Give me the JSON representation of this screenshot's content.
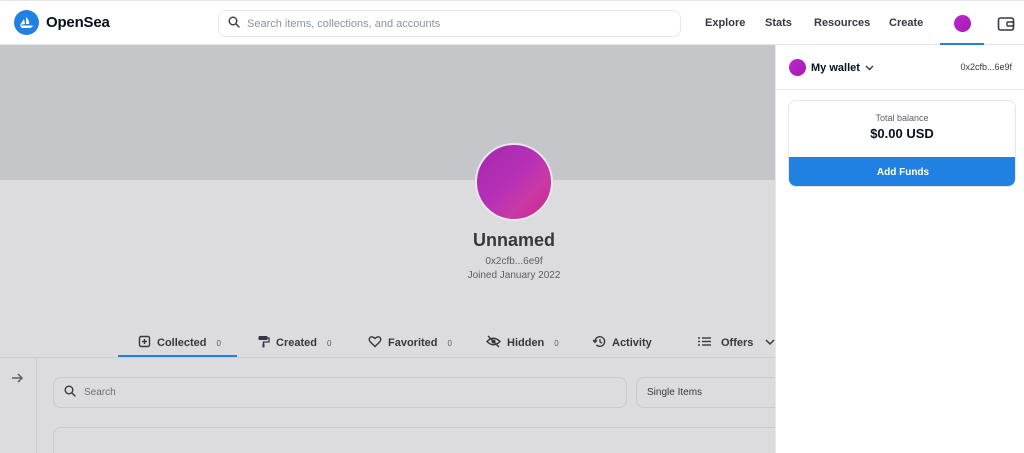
{
  "header": {
    "brand": "OpenSea",
    "search_placeholder": "Search items, collections, and accounts",
    "nav": [
      "Explore",
      "Stats",
      "Resources",
      "Create"
    ]
  },
  "profile": {
    "name": "Unnamed",
    "address": "0x2cfb...6e9f",
    "joined": "Joined January 2022"
  },
  "tabs": [
    {
      "label": "Collected",
      "count": "0"
    },
    {
      "label": "Created",
      "count": "0"
    },
    {
      "label": "Favorited",
      "count": "0"
    },
    {
      "label": "Hidden",
      "count": "0"
    },
    {
      "label": "Activity"
    },
    {
      "label": "Offers"
    }
  ],
  "items": {
    "search_placeholder": "Search",
    "filter_selected": "Single Items"
  },
  "wallet": {
    "title": "My wallet",
    "address": "0x2cfb...6e9f",
    "balance_label": "Total balance",
    "balance_value": "$0.00 USD",
    "add_funds_label": "Add Funds"
  },
  "colors": {
    "accent": "#2081e2",
    "avatar": "#b72fb8",
    "banner": "#c5c6ca"
  }
}
